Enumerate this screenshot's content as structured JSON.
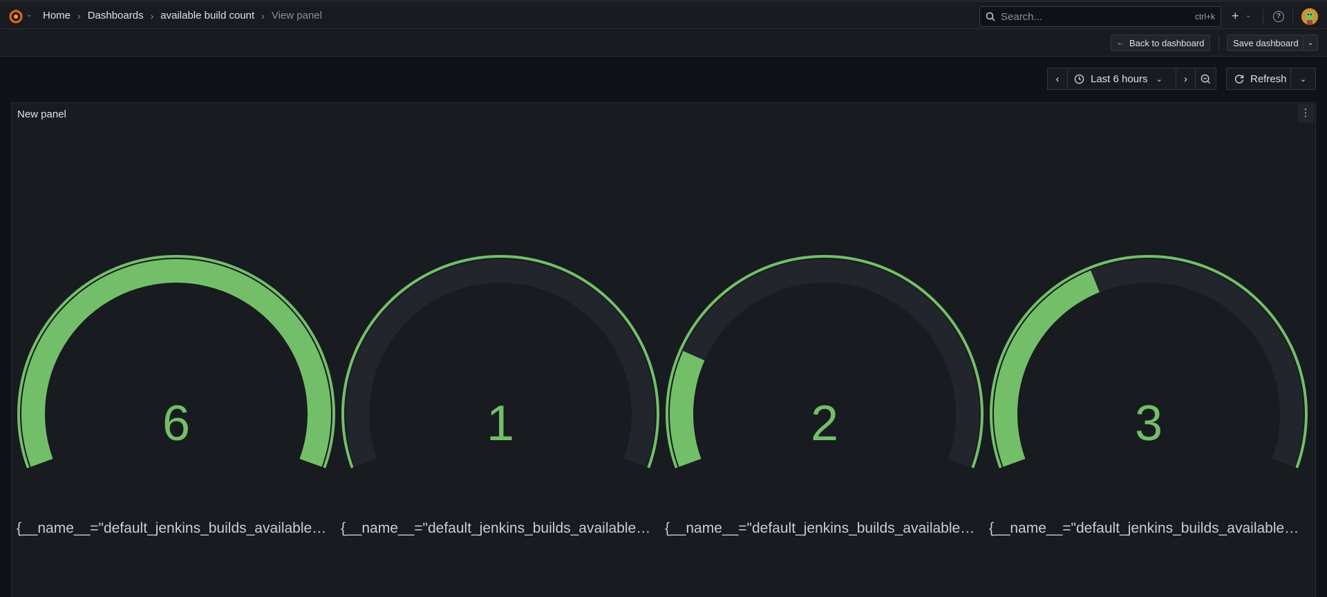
{
  "breadcrumb": {
    "home": "Home",
    "dashboards": "Dashboards",
    "dashboard": "available build count",
    "current": "View panel"
  },
  "search": {
    "placeholder": "Search...",
    "shortcut": "ctrl+k"
  },
  "toolbar": {
    "back_label": "Back to dashboard",
    "save_label": "Save dashboard"
  },
  "time": {
    "range_label": "Last 6 hours",
    "refresh_label": "Refresh"
  },
  "panel": {
    "title": "New panel"
  },
  "gauges": [
    {
      "value": 6,
      "display": "6",
      "fraction": 1.0,
      "label": "{__name__=\"default_jenkins_builds_available_..."
    },
    {
      "value": 1,
      "display": "1",
      "fraction": 0.0,
      "label": "{__name__=\"default_jenkins_builds_available_..."
    },
    {
      "value": 2,
      "display": "2",
      "fraction": 0.2,
      "label": "{__name__=\"default_jenkins_builds_available_..."
    },
    {
      "value": 3,
      "display": "3",
      "fraction": 0.4,
      "label": "{__name__=\"default_jenkins_builds_available_..."
    }
  ],
  "colors": {
    "gauge_fill": "#73bf69",
    "gauge_track": "#22252b",
    "text_value": "#73bf69"
  }
}
